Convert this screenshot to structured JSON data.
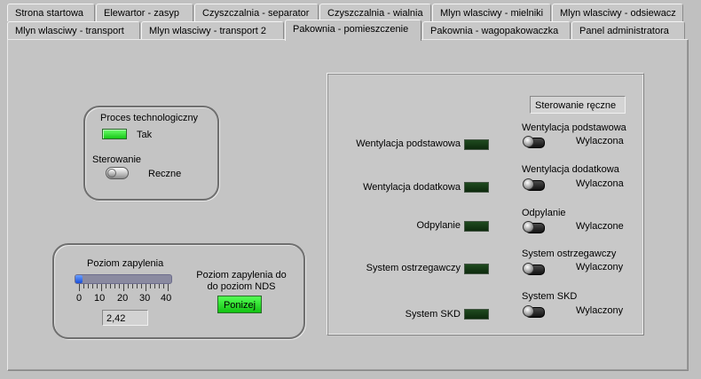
{
  "tabs_row1": [
    "Strona startowa",
    "Elewartor - zasyp",
    "Czyszczalnia - separator",
    "Czyszczalnia - wialnia",
    "Mlyn wlasciwy - mielniki",
    "Mlyn wlasciwy - odsiewacz"
  ],
  "tabs_row2": [
    "Mlyn wlasciwy - transport",
    "Mlyn wlasciwy - transport 2",
    "Pakownia - pomieszczenie",
    "Pakownia - wagopakowaczka",
    "Panel administratora"
  ],
  "active_tab": "Pakownia - pomieszczenie",
  "process": {
    "label": "Proces technologiczny",
    "status": "Tak",
    "control_label": "Sterowanie",
    "control_value": "Reczne"
  },
  "dust": {
    "label": "Poziom zapylenia",
    "value": "2,42",
    "level": 2.42,
    "scale_max": 40,
    "ticks": [
      "0",
      "10",
      "20",
      "30",
      "40"
    ],
    "nds_label_line1": "Poziom zapylenia do",
    "nds_label_line2": "do poziom NDS",
    "nds_status": "Ponizej"
  },
  "manual": {
    "title": "Sterowanie ręczne",
    "indicators": [
      "Wentylacja podstawowa",
      "Wentylacja dodatkowa",
      "Odpylanie",
      "System ostrzegawczy",
      "System SKD"
    ],
    "switches": [
      {
        "label": "Wentylacja podstawowa",
        "state": "Wylaczona"
      },
      {
        "label": "Wentylacja dodatkowa",
        "state": "Wylaczona"
      },
      {
        "label": "Odpylanie",
        "state": "Wylaczone"
      },
      {
        "label": "System ostrzegawczy",
        "state": "Wylaczony"
      },
      {
        "label": "System SKD",
        "state": "Wylaczony"
      }
    ]
  }
}
